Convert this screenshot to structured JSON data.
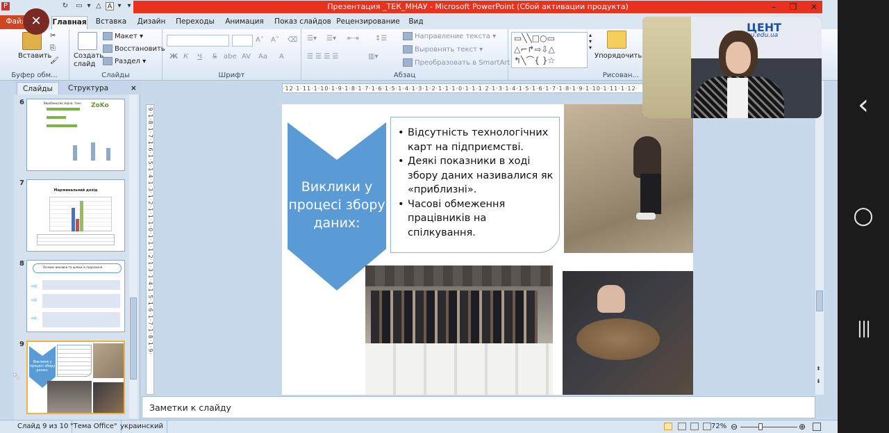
{
  "window": {
    "title": "Презентация _ТЕК_МНАУ  -  Microsoft PowerPoint (Сбой активации продукта)",
    "controls": [
      "–",
      "❐",
      "✕"
    ]
  },
  "tabs": [
    {
      "label": "Файл"
    },
    {
      "label": "Главная"
    },
    {
      "label": "Вставка"
    },
    {
      "label": "Дизайн"
    },
    {
      "label": "Переходы"
    },
    {
      "label": "Анимация"
    },
    {
      "label": "Показ слайдов"
    },
    {
      "label": "Рецензирование"
    },
    {
      "label": "Вид"
    }
  ],
  "ribbon": {
    "clipboard": {
      "paste": "Вставить",
      "group": "Буфер обм..."
    },
    "slides": {
      "new_slide": "Создать слайд",
      "layout": "Макет ▾",
      "reset": "Восстановить",
      "section": "Раздел ▾",
      "group": "Слайды"
    },
    "font": {
      "group": "Шрифт",
      "bold": "Ж",
      "italic": "К",
      "underline": "Ч",
      "strike": "S",
      "shadow": "abe",
      "spacing": "AV",
      "case": "Aa",
      "grow": "A˄",
      "shrink": "A˅"
    },
    "paragraph": {
      "group": "Абзац",
      "direction": "Направление текста ▾",
      "align": "Выровнять текст ▾",
      "smartart": "Преобразовать в SmartArt ▾"
    },
    "drawing": {
      "arrange": "Упорядочить",
      "group": "Рисован..."
    }
  },
  "left_panel": {
    "tabs": [
      "Слайды",
      "Структура"
    ],
    "close": "×",
    "slides": [
      {
        "num": "6",
        "brand": "ZoKo",
        "caption": "Виробництво зерна, тонн"
      },
      {
        "num": "7",
        "caption": "Маржинальний дохід"
      },
      {
        "num": "8",
        "caption": "Основні виклики та шляхи їх подолання"
      },
      {
        "num": "9",
        "caption": "Виклики у процесі збору даних:"
      }
    ]
  },
  "ruler": {
    "h": "·12·1·11·1·10·1·9·1·8·1·7·1·6·1·5·1·4·1·3·1·2·1·1·1·0·1·1·1·2·1·3·1·4·1·5·1·6·1·7·1·8·1·9·1·10·1·11·1·12·",
    "v": "·9·1·8·1·7·1·6·1·5·1·4·1·3·1·2·1·1·1·0·1·1·1·2·1·3·1·4·1·5·1·6·1·7·1·8·1·9·"
  },
  "slide": {
    "chevron_title": "Виклики у процесі збору даних:",
    "bullets": [
      "Відсутність технологічних карт на підприємстві.",
      "Деякі показники в ході збору даних називалися як «приблизні».",
      "Часові обмеження працівників на спілкування."
    ],
    "colors": {
      "chevron": "#5b9bd5",
      "border": "#8fb1dd"
    }
  },
  "notes": {
    "placeholder": "Заметки к слайду"
  },
  "status": {
    "slide": "Слайд 9 из 10",
    "theme": "\"Тема Office\"",
    "lang": "украинский",
    "zoom": "72%"
  },
  "webcam": {
    "sign": "ЦЕНТ",
    "url": "nu.edu.ua"
  },
  "android_nav": {
    "back": "‹",
    "home": "○",
    "recent": "|||"
  }
}
